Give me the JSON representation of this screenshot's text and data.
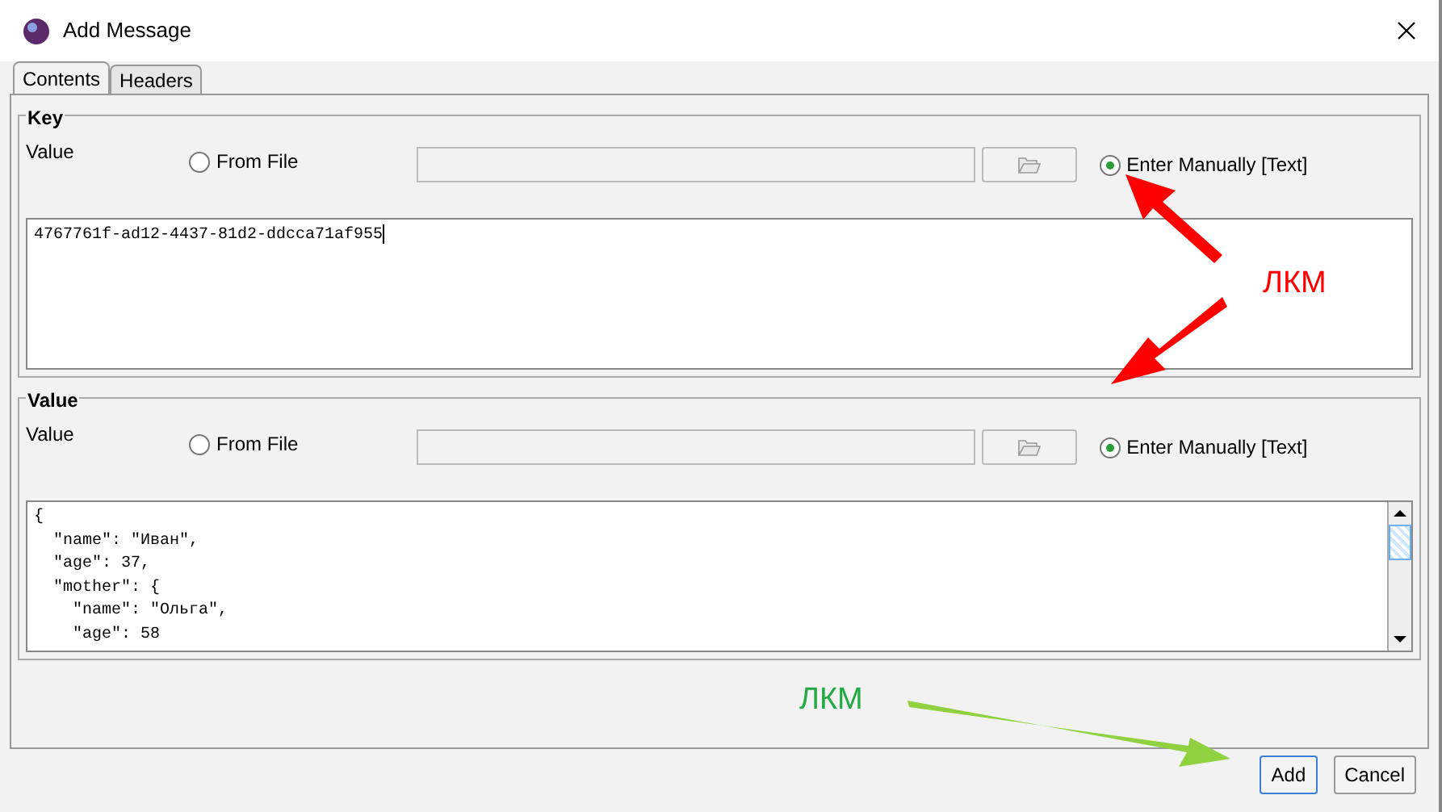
{
  "window": {
    "title": "Add Message"
  },
  "tabs": [
    {
      "label": "Contents",
      "selected": true
    },
    {
      "label": "Headers",
      "selected": false
    }
  ],
  "key": {
    "group_title": "Key",
    "row_label": "Value",
    "options": [
      {
        "label": "From File",
        "selected": false
      },
      {
        "label": "Enter Manually [Text]",
        "selected": true
      }
    ],
    "lines": [
      "4767761f-ad12-4437-81d2-ddcca71af955"
    ]
  },
  "value": {
    "group_title": "Value",
    "row_label": "Value",
    "options": [
      {
        "label": "From File",
        "selected": false
      },
      {
        "label": "Enter Manually [Text]",
        "selected": true
      }
    ],
    "lines": [
      "{",
      "  \"name\": \"Иван\",",
      "  \"age\": 37,",
      "  \"mother\": {",
      "    \"name\": \"Ольга\",",
      "    \"age\": 58"
    ]
  },
  "buttons": [
    {
      "label": "Add",
      "selected": true
    },
    {
      "label": "Cancel",
      "selected": false
    }
  ],
  "annotations": [
    {
      "text": "ЛКМ",
      "color": "#ff0000"
    },
    {
      "text": "ЛКМ",
      "color": "#22aa44"
    }
  ]
}
